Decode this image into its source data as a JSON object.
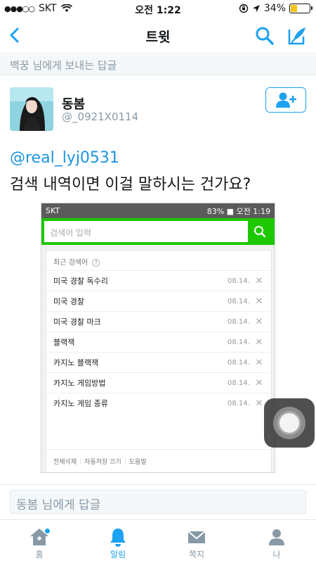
{
  "status_bar": {
    "carrier": "SKT",
    "time": "오전 1:22",
    "battery_percent": "34%",
    "battery_level": 0.34
  },
  "nav": {
    "title": "트윗"
  },
  "reply_banner": "백꿍 님에게 보내는 답글",
  "author": {
    "name": "동봄",
    "handle": "@_0921X0114"
  },
  "tweet": {
    "mention": "@real_lyj0531",
    "text": "검색 내역이면 이걸 말하시는 건가요?"
  },
  "embedded": {
    "status_left": "SKT",
    "status_right": "83% ■ 오전 1:19",
    "search_placeholder": "검색어 입력",
    "recent_label": "최근 검색어",
    "items": [
      {
        "keyword": "미국 경찰 독수리",
        "date": "08.14."
      },
      {
        "keyword": "미국 경찰",
        "date": "08.14."
      },
      {
        "keyword": "미국 경찰 마크",
        "date": "08.14."
      },
      {
        "keyword": "블랙잭",
        "date": "08.14."
      },
      {
        "keyword": "카지노 블랙잭",
        "date": "08.14."
      },
      {
        "keyword": "카지노 게임방법",
        "date": "08.14."
      },
      {
        "keyword": "카지노 게임 종류",
        "date": "08.14."
      }
    ],
    "footer": {
      "delete_all": "전체삭제",
      "autosave_off": "자동저장 끄기",
      "help": "도움말"
    }
  },
  "reply_placeholder": "동봄 님에게 답글",
  "tabs": [
    {
      "label": "홈"
    },
    {
      "label": "알림"
    },
    {
      "label": "쪽지"
    },
    {
      "label": "나"
    }
  ],
  "colors": {
    "accent": "#1da1f2",
    "naver_green": "#1ec800"
  }
}
